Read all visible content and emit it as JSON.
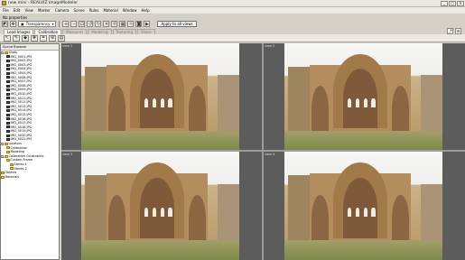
{
  "window": {
    "title": "new mini - REALVIZ ImageModeler"
  },
  "menu": [
    "File",
    "Edit",
    "View",
    "Marker",
    "Camera",
    "Scene",
    "Rules",
    "Material",
    "Window",
    "Help"
  ],
  "properties_label": "No properties",
  "toolbar": {
    "transparency": "Transparency",
    "apply_button": "Apply to all views"
  },
  "tabs": [
    {
      "label": "Load Images",
      "active": true
    },
    {
      "label": "Calibration",
      "active": true
    },
    {
      "label": "Measures",
      "active": false
    },
    {
      "label": "Modeling",
      "active": false
    },
    {
      "label": "Texturing",
      "active": false
    },
    {
      "label": "Share",
      "active": false
    }
  ],
  "tree": {
    "header": "Scene Browser",
    "root": "Shots",
    "images": [
      "IMG_0001.JPG",
      "IMG_0002.JPG",
      "IMG_0003.JPG",
      "IMG_0004.JPG",
      "IMG_0005.JPG",
      "IMG_0006.JPG",
      "IMG_0007.JPG",
      "IMG_0008.JPG",
      "IMG_0009.JPG",
      "IMG_0010.JPG",
      "IMG_0011.JPG",
      "IMG_0012.JPG",
      "IMG_0013.JPG",
      "IMG_0014.JPG",
      "IMG_0015.JPG",
      "IMG_0016.JPG",
      "IMG_0017.JPG",
      "IMG_0018.JPG",
      "IMG_0019.JPG",
      "IMG_0020.JPG",
      "IMG_0021.JPG"
    ],
    "groups": [
      "Locators",
      "Calibration",
      "Modeling",
      "Calibration Constraints",
      "Custom Frame",
      "Stereo 1",
      "Stereo 2",
      "Objects",
      "Materials"
    ]
  },
  "views": [
    {
      "label": "view 1"
    },
    {
      "label": "view 2"
    },
    {
      "label": "view 3"
    },
    {
      "label": "view 4"
    }
  ]
}
